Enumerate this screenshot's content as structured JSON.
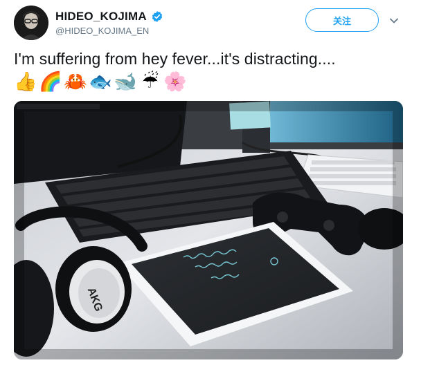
{
  "tweet": {
    "display_name": "HIDEO_KOJIMA",
    "handle": "@HIDEO_KOJIMA_EN",
    "follow_label": "关注",
    "text": "I'm suffering from hey fever...it's distracting....",
    "emojis": [
      "👍",
      "🌈",
      "🦀",
      "🐟",
      "🐋",
      "☔",
      "🌸"
    ],
    "verified": true
  },
  "media": {
    "headphone_brand": "AKG",
    "colors": {
      "accent": "#1da1f2",
      "text": "#14171a",
      "muted": "#657786"
    }
  }
}
